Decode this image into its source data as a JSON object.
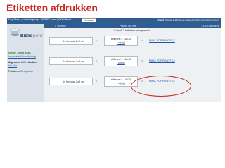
{
  "slide": {
    "title": "Etiketten afdrukken"
  },
  "topbar": {
    "greeting": "Dag Theo , je bent ingelogd. BIBNET scan | 1000 bibnet",
    "scan_button": "rsbn scan",
    "brand": "sbnl",
    "brand_sub": "SCHOLZ BENELUX  BIBLIOTHEEKVOORZIENINGEN"
  },
  "sidebar": {
    "logo_text_main": "Biblio",
    "logo_text_accent": "print",
    "product": "Nieuw - ISBN scan",
    "product_link": "Informatie & handleiding",
    "info_head": "Algemene info etiketten:",
    "info_link": "klik hier",
    "problems_label": "Problemen?",
    "problems_link": "helpdesk"
  },
  "nav": {
    "back": "TERUG",
    "title": "PRINT SETUP",
    "logout": "UITLOGGEN"
  },
  "notice": "U heeft 3 etiketten aangemaakt.",
  "rows": [
    {
      "format": "8x formaat 2x2 cm",
      "eq": "=",
      "stat": "etiketvel = 1A /70",
      "wijzig": "[ wijzig ]",
      "eq2": "=",
      "maak": "MAAK PDF-PRINTFILE"
    },
    {
      "format": "2x formaat 2x4 cm",
      "eq": "=",
      "stat": "etiketvel = 1A /40",
      "wijzig": "[ wijzig ]",
      "eq2": "=",
      "maak": "MAAK PDF-PRINTFILE"
    },
    {
      "format": "1x formaat 2x8 cm",
      "eq": "=",
      "stat": "etiketvel = 1A /20",
      "wijzig": "[ wijzig ]",
      "eq2": "=",
      "maak": "MAAK PDF-PRINTFILE"
    }
  ],
  "colors": {
    "title": "#c8281e",
    "header_bar": "#2f5d8f",
    "sidebar_bg": "#dbe2ea",
    "link": "#2556a6",
    "highlight": "#c8281e"
  }
}
